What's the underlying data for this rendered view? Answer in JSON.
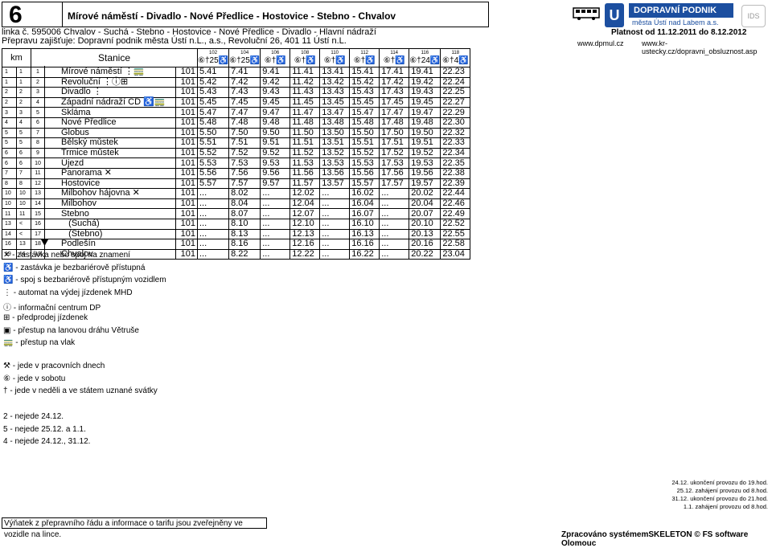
{
  "header": {
    "line_number": "6",
    "route": "Mírové náměstí - Divadlo - Nové Předlice - Hostovice - Stebno - Chvalov",
    "line_info": "linka č. 595006 Chvalov - Suchá - Stebno - Hostovice - Nové Předlice - Divadlo - Hlavní nádraží",
    "operator": "Přepravu zajišťuje: Dopravní podnik města Ústí n.L., a.s., Revoluční 26, 401 11 Ústí n.L.",
    "valid": "Platnost od 11.12.2011 do 8.12.2012",
    "url1": "www.dpmul.cz",
    "url2": "www.kr-ustecky.cz/dopravni_obsluznost.asp",
    "logo_text": "DOPRAVNÍ PODNIK",
    "logo_sub": "města Ústí nad Labem a.s."
  },
  "columns": {
    "km": "km",
    "stop": "Stanice",
    "trips": [
      {
        "num": "102",
        "sym": "⑥†25♿"
      },
      {
        "num": "104",
        "sym": "⑥†25♿"
      },
      {
        "num": "106",
        "sym": "⑥†♿"
      },
      {
        "num": "108",
        "sym": "⑥†♿"
      },
      {
        "num": "110",
        "sym": "⑥†♿"
      },
      {
        "num": "112",
        "sym": "⑥†♿"
      },
      {
        "num": "114",
        "sym": "⑥†♿"
      },
      {
        "num": "116",
        "sym": "⑥†24♿"
      },
      {
        "num": "118",
        "sym": "⑥†4♿"
      }
    ]
  },
  "rows": [
    {
      "km1": "1",
      "km2": "1",
      "seq": "1",
      "stop": "Mírové náměstí ⋮🚃",
      "zone": "101",
      "t": [
        "5.41",
        "7.41",
        "9.41",
        "11.41",
        "13.41",
        "15.41",
        "17.41",
        "19.41",
        "22.23"
      ]
    },
    {
      "km1": "1",
      "km2": "1",
      "seq": "2",
      "stop": "Revoluční ⋮ⓘ⊞",
      "zone": "101",
      "t": [
        "5.42",
        "7.42",
        "9.42",
        "11.42",
        "13.42",
        "15.42",
        "17.42",
        "19.42",
        "22.24"
      ]
    },
    {
      "km1": "2",
      "km2": "2",
      "seq": "3",
      "stop": "Divadlo ⋮",
      "zone": "101",
      "t": [
        "5.43",
        "7.43",
        "9.43",
        "11.43",
        "13.43",
        "15.43",
        "17.43",
        "19.43",
        "22.25"
      ]
    },
    {
      "km1": "2",
      "km2": "2",
      "seq": "4",
      "stop": "Západní nádraží CD ♿🚃",
      "zone": "101",
      "t": [
        "5.45",
        "7.45",
        "9.45",
        "11.45",
        "13.45",
        "15.45",
        "17.45",
        "19.45",
        "22.27"
      ]
    },
    {
      "km1": "3",
      "km2": "3",
      "seq": "5",
      "stop": "Skláma",
      "zone": "101",
      "t": [
        "5.47",
        "7.47",
        "9.47",
        "11.47",
        "13.47",
        "15.47",
        "17.47",
        "19.47",
        "22.29"
      ]
    },
    {
      "km1": "4",
      "km2": "4",
      "seq": "6",
      "stop": "Nové Předlice",
      "zone": "101",
      "t": [
        "5.48",
        "7.48",
        "9.48",
        "11.48",
        "13.48",
        "15.48",
        "17.48",
        "19.48",
        "22.30"
      ]
    },
    {
      "km1": "5",
      "km2": "5",
      "seq": "7",
      "stop": "Globus",
      "zone": "101",
      "t": [
        "5.50",
        "7.50",
        "9.50",
        "11.50",
        "13.50",
        "15.50",
        "17.50",
        "19.50",
        "22.32"
      ]
    },
    {
      "km1": "5",
      "km2": "5",
      "seq": "8",
      "stop": "Bělský můstek",
      "zone": "101",
      "t": [
        "5.51",
        "7.51",
        "9.51",
        "11.51",
        "13.51",
        "15.51",
        "17.51",
        "19.51",
        "22.33"
      ]
    },
    {
      "km1": "6",
      "km2": "6",
      "seq": "9",
      "stop": "Trmice můstek",
      "zone": "101",
      "t": [
        "5.52",
        "7.52",
        "9.52",
        "11.52",
        "13.52",
        "15.52",
        "17.52",
        "19.52",
        "22.34"
      ]
    },
    {
      "km1": "6",
      "km2": "6",
      "seq": "10",
      "stop": "Újezd",
      "zone": "101",
      "t": [
        "5.53",
        "7.53",
        "9.53",
        "11.53",
        "13.53",
        "15.53",
        "17.53",
        "19.53",
        "22.35"
      ]
    },
    {
      "km1": "7",
      "km2": "7",
      "seq": "11",
      "stop": "Panorama ✕",
      "zone": "101",
      "t": [
        "5.56",
        "7.56",
        "9.56",
        "11.56",
        "13.56",
        "15.56",
        "17.56",
        "19.56",
        "22.38"
      ]
    },
    {
      "km1": "8",
      "km2": "8",
      "seq": "12",
      "stop": "Hostovice",
      "zone": "101",
      "t": [
        "5.57",
        "7.57",
        "9.57",
        "11.57",
        "13.57",
        "15.57",
        "17.57",
        "19.57",
        "22.39"
      ]
    },
    {
      "km1": "10",
      "km2": "10",
      "seq": "13",
      "stop": "Milbohov hájovna ✕",
      "zone": "101",
      "t": [
        "...",
        "8.02",
        "...",
        "12.02",
        "...",
        "16.02",
        "...",
        "20.02",
        "22.44"
      ]
    },
    {
      "km1": "10",
      "km2": "10",
      "seq": "14",
      "stop": "Milbohov",
      "zone": "101",
      "t": [
        "...",
        "8.04",
        "...",
        "12.04",
        "...",
        "16.04",
        "...",
        "20.04",
        "22.46"
      ]
    },
    {
      "km1": "11",
      "km2": "11",
      "seq": "15",
      "stop": "Stebno",
      "zone": "101",
      "t": [
        "...",
        "8.07",
        "...",
        "12.07",
        "...",
        "16.07",
        "...",
        "20.07",
        "22.49"
      ]
    },
    {
      "km1": "13",
      "km2": "<",
      "seq": "16",
      "stop": "   (Suchá)",
      "zone": "101",
      "t": [
        "...",
        "8.10",
        "...",
        "12.10",
        "...",
        "16.10",
        "...",
        "20.10",
        "22.52"
      ]
    },
    {
      "km1": "14",
      "km2": "<",
      "seq": "17",
      "stop": "   (Stebno)",
      "zone": "101",
      "t": [
        "...",
        "8.13",
        "...",
        "12.13",
        "...",
        "16.13",
        "...",
        "20.13",
        "22.55"
      ]
    },
    {
      "km1": "16",
      "km2": "13",
      "seq": "18",
      "stop": "Podlešín",
      "zone": "101",
      "t": [
        "...",
        "8.16",
        "...",
        "12.16",
        "...",
        "16.16",
        "...",
        "20.16",
        "22.58"
      ]
    },
    {
      "km1": "19",
      "km2": "16",
      "seq": "19",
      "stop": "Chvalov",
      "zone": "101",
      "t": [
        "...",
        "8.22",
        "...",
        "12.22",
        "...",
        "16.22",
        "...",
        "20.22",
        "23.04"
      ]
    }
  ],
  "legend": [
    "✕ - zastávka nebo spoj na znamení",
    "♿ - zastávka je bezbariérově přístupná",
    "♿ - spoj s bezbariérově přístupným vozidlem",
    "⋮ - automat na výdej jízdenek MHD",
    "ⓘ - informační centrum DP",
    "⊞ - předprodej jízdenek",
    "▣ - přestup na lanovou dráhu Větruše",
    "🚃 - přestup na vlak"
  ],
  "legend2": [
    "⚒ - jede v pracovních dnech",
    "⑥ - jede v sobotu",
    "† - jede v neděli a ve státem uznané svátky"
  ],
  "legend3": [
    "2 - nejede 24.12.",
    "5 - nejede 25.12. a 1.1.",
    "4 - nejede 24.12., 31.12."
  ],
  "notes_br": [
    "24.12. ukončení provozu do 19.hod.",
    "25.12. zahájení provozu od 8.hod.",
    "31.12. ukončení provozu do 21.hod.",
    "1.1. zahájení provozu od 8.hod."
  ],
  "footer": "Výňatek z přepravního řádu a informace o tarifu jsou zveřejněny ve vozidle na lince.",
  "software": "Zpracováno systémemSKELETON © FS software Olomouc"
}
